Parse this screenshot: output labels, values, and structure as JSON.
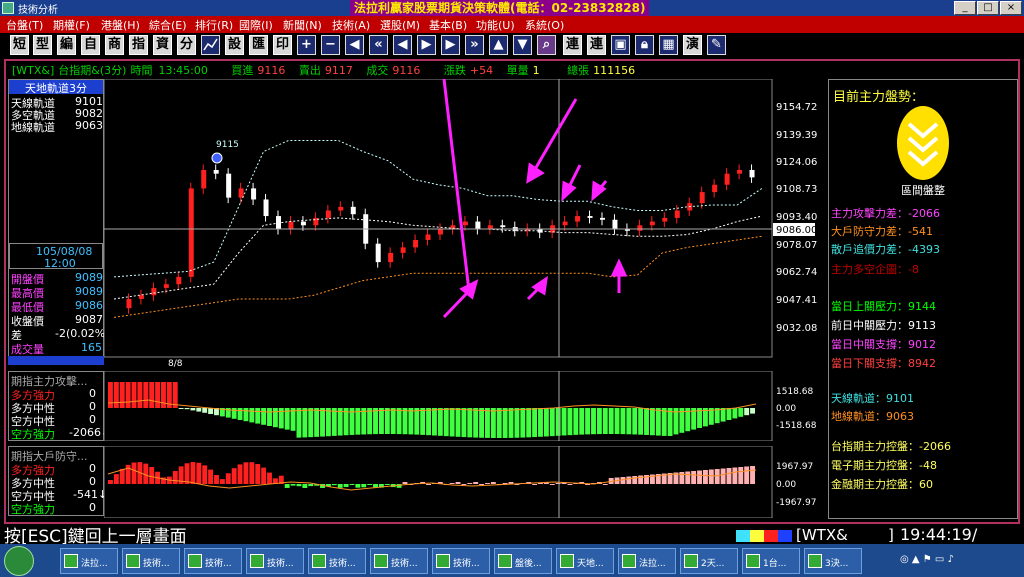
{
  "window": {
    "title": "技術分析",
    "center_title": "法拉利贏家股票期貨決策軟體(電話：02-23832828)"
  },
  "menu": [
    {
      "label": "台盤(T)"
    },
    {
      "label": "期權(F)"
    },
    {
      "label": "港盤(H)"
    },
    {
      "label": "綜合(E)"
    },
    {
      "label": "排行(R)"
    },
    {
      "label": "國際(I)"
    },
    {
      "label": "新聞(N)"
    },
    {
      "label": "技術(A)"
    },
    {
      "label": "選股(M)"
    },
    {
      "label": "基本(B)"
    },
    {
      "label": "功能(U)"
    },
    {
      "label": "系統(O)"
    }
  ],
  "toolbar": {
    "text_buttons": [
      "短",
      "型",
      "編",
      "自",
      "商",
      "指",
      "資",
      "分"
    ],
    "text_buttons2": [
      "設",
      "匯",
      "印"
    ],
    "text_buttons3": [
      "連",
      "連"
    ],
    "text_buttons4": [
      "演"
    ]
  },
  "quote": {
    "symbol": "[WTX&]",
    "name": "台指期&(3分)",
    "time_label": "時間",
    "time": "13:45:00",
    "bid_label": "買進",
    "bid": "9116",
    "ask_label": "賣出",
    "ask": "9117",
    "trade_label": "成交",
    "trade": "9116",
    "change_label": "漲跌",
    "change": "+54",
    "volume_label": "單量",
    "volume": "1",
    "total_label": "總張",
    "total": "111156"
  },
  "left_panel": {
    "header": "天地軌道3分",
    "rows": [
      {
        "label": "天線軌道",
        "value": "9101",
        "color": "#ffffff"
      },
      {
        "label": "多空軌道",
        "value": "9082",
        "color": "#ffffff"
      },
      {
        "label": "地線軌道",
        "value": "9063",
        "color": "#ffffff"
      }
    ],
    "date": "105/08/08",
    "time": "12:00",
    "stats": [
      {
        "label": "開盤價",
        "value": "9089"
      },
      {
        "label": "最高價",
        "value": "9089"
      },
      {
        "label": "最低價",
        "value": "9086"
      },
      {
        "label": "收盤價",
        "value": "9087"
      },
      {
        "label": "差",
        "value": "-2(0.02%)"
      },
      {
        "label": "成交量",
        "value": "165"
      }
    ]
  },
  "main_chart": {
    "y_ticks": [
      "9154.72",
      "9139.39",
      "9124.06",
      "9108.73",
      "9093.40",
      "9078.07",
      "9062.74",
      "9047.41",
      "9032.08"
    ],
    "current_price": "9086.00",
    "date_label": "8/8",
    "marker_label": "9115"
  },
  "sub_chart1": {
    "title": "期指主力攻擊...",
    "rows": [
      {
        "label": "多方強力",
        "value": "0",
        "color": "#ff2020"
      },
      {
        "label": "多方中性",
        "value": "0",
        "color": "#ffffff"
      },
      {
        "label": "空方中性",
        "value": "0",
        "color": "#ffffff"
      },
      {
        "label": "空方強力",
        "value": "-2066↓",
        "color": "#00ff00"
      }
    ],
    "y_ticks": [
      "1518.68",
      "0.00",
      "-1518.68"
    ]
  },
  "sub_chart2": {
    "title": "期指大戶防守...",
    "rows": [
      {
        "label": "多方強力",
        "value": "0",
        "color": "#ff2020"
      },
      {
        "label": "多方中性",
        "value": "0",
        "color": "#ffffff"
      },
      {
        "label": "空方中性",
        "value": "-541↓",
        "color": "#ffffff"
      },
      {
        "label": "空方強力",
        "value": "0",
        "color": "#00ff00"
      }
    ],
    "y_ticks": [
      "1967.97",
      "0.00",
      "-1967.97"
    ]
  },
  "right_panel": {
    "title": "目前主力盤勢：",
    "badge_label": "區間盤整",
    "group1": [
      {
        "text": "主力攻擊力差：-2066",
        "color": "#ff44ff"
      },
      {
        "text": "大戶防守力差：-541",
        "color": "#ff9020"
      },
      {
        "text": "散戶追價力差：-4393",
        "color": "#40e0e0"
      },
      {
        "text": "主力多空企圖：-8",
        "color": "#c00000"
      }
    ],
    "group2": [
      {
        "text": "當日上關壓力：9144",
        "color": "#00ff00"
      },
      {
        "text": "前日中關壓力：9113",
        "color": "#ffffff"
      },
      {
        "text": "當日中關支撐：9012",
        "color": "#ff44ff"
      },
      {
        "text": "當日下關支撐：8942",
        "color": "#ff4040"
      }
    ],
    "group3": [
      {
        "text": "天線軌道：9101",
        "color": "#40e0e0"
      },
      {
        "text": "地線軌道：9063",
        "color": "#ff9020"
      }
    ],
    "group4": [
      {
        "text": "台指期主力控盤：-2066",
        "color": "#ffff60"
      },
      {
        "text": "電子期主力控盤：-48",
        "color": "#ffff60"
      },
      {
        "text": "金融期主力控盤：60",
        "color": "#ffff60"
      }
    ]
  },
  "status": {
    "esc_hint": "按[ESC]鍵回上一層畫面",
    "symbol": "[WTX&",
    "bracket": "]",
    "clock": "19:44:19/"
  },
  "taskbar": [
    {
      "label": "法拉..."
    },
    {
      "label": "技術..."
    },
    {
      "label": "技術..."
    },
    {
      "label": "技術..."
    },
    {
      "label": "技術..."
    },
    {
      "label": "技術..."
    },
    {
      "label": "技術..."
    },
    {
      "label": "盤後..."
    },
    {
      "label": "天地..."
    },
    {
      "label": "法拉..."
    },
    {
      "label": "2天..."
    },
    {
      "label": "1台..."
    },
    {
      "label": "3決..."
    }
  ],
  "colors": {
    "up": "#ff2020",
    "down": "#ffffff",
    "sky": "#c8ffff",
    "ground": "#ff9020",
    "mid": "#ffffff",
    "arrow": "#ff20ff"
  }
}
